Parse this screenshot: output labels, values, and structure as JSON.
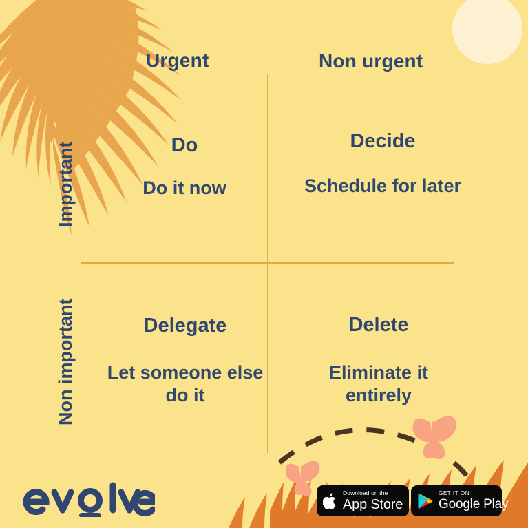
{
  "poster": {
    "background_color": "#fbe38c",
    "ink_color": "#2f4770",
    "accent_color": "#e8a845",
    "frond_color": "#e8a54d",
    "butterfly_color": "#f8a381",
    "sun_color": "#fdf1d2",
    "grass_color": "#e07a2b",
    "dash_color": "#4a3520"
  },
  "matrix": {
    "columns": [
      {
        "label": "Urgent"
      },
      {
        "label": "Non urgent"
      }
    ],
    "rows": [
      {
        "label": "Important"
      },
      {
        "label": "Non important"
      }
    ],
    "quadrants": [
      {
        "key": "do",
        "title": "Do",
        "description": "Do it now"
      },
      {
        "key": "decide",
        "title": "Decide",
        "description": "Schedule for later"
      },
      {
        "key": "delegate",
        "title": "Delegate",
        "description": "Let someone else do it"
      },
      {
        "key": "delete",
        "title": "Delete",
        "description": "Eliminate it entirely"
      }
    ]
  },
  "brand": {
    "name": "evolve",
    "name_part_1": "ev",
    "name_part_2": "lve",
    "logo_icon": "evolve-o-ring-icon"
  },
  "store_badges": [
    {
      "key": "appstore",
      "icon": "apple-logo-icon",
      "small_text": "Download on the",
      "big_text": "App Store"
    },
    {
      "key": "googleplay",
      "icon": "google-play-triangle-icon",
      "small_text": "GET IT ON",
      "big_text": "Google Play"
    }
  ],
  "decorations": [
    {
      "name": "palm-frond",
      "position": "top-left"
    },
    {
      "name": "sun-circle",
      "position": "top-right"
    },
    {
      "name": "dashed-arc",
      "position": "bottom-right"
    },
    {
      "name": "butterfly-large",
      "position": "bottom-right"
    },
    {
      "name": "butterfly-small",
      "position": "bottom-center"
    },
    {
      "name": "grass-silhouette",
      "position": "bottom-right"
    }
  ]
}
